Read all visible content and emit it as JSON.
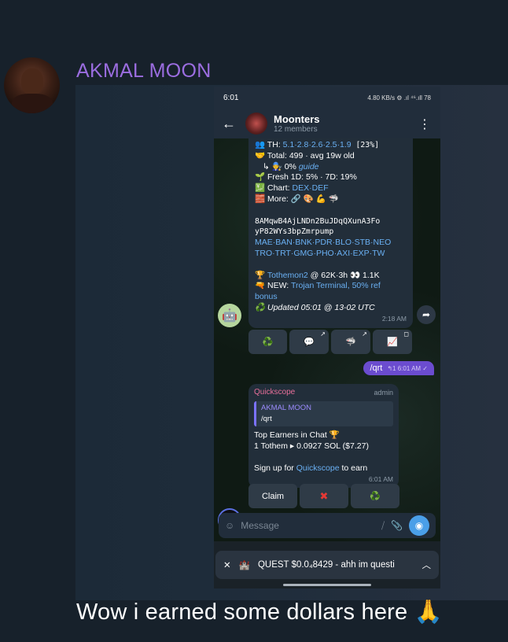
{
  "post": {
    "sender_name": "AKMAL MOON",
    "caption": "Wow i earned  some dollars here 🙏"
  },
  "phone": {
    "status": {
      "time": "6:01",
      "icons": "4.80 KB/s ⚙ .ıl ⁴⁶.ıll 78"
    },
    "header": {
      "title": "Moonters",
      "subtitle": "12 members"
    },
    "bot_message": {
      "lines": {
        "th_prefix": "👥 TH: ",
        "th_values": "5.1·2.8·2.6·2.5·1.9",
        "th_pct": " [23%]",
        "total": "🤝 Total: 499 · avg 19w old",
        "guide_prefix": "↳ 🧑‍🔧 0% ",
        "guide_link": "guide",
        "fresh": "🌱 Fresh 1D: 5% · 7D: 19%",
        "chart_prefix": "💹 Chart: ",
        "chart_link": "DEX·DEF",
        "more": "🧱 More: 🔗 🎨 💪 🦈",
        "addr1": "8AMqwB4AjLNDn2BuJDqQXunA3Fo",
        "addr2": "yP82WYs3bpZmrpump",
        "links1": "MAE·BAN·BNK·PDR·BLO·STB·NEO",
        "links2": "TRO·TRT·GMG·PHO·AXI·EXP·TW",
        "trophy_prefix": "🏆 ",
        "trophy_link": "Tothemon2",
        "trophy_rest": " @ 62K·3h 👀 1.1K",
        "new_prefix": "🔫 NEW: ",
        "new_link": "Trojan Terminal, 50% ref",
        "new_link2": "bonus",
        "updated": "♻️ Updated 05:01 @ 13-02 UTC"
      },
      "time": "2:18 AM"
    },
    "bot_buttons": [
      "♻️",
      "💬",
      "🦈",
      "📈"
    ],
    "outgoing": {
      "text": "/qrt",
      "meta": "↰1 6:01 AM ✓"
    },
    "quickscope": {
      "name": "Quickscope",
      "role": "admin",
      "quote_name": "AKMAL MOON",
      "quote_text": "/qrt",
      "line1": "Top Earners in Chat 🏆",
      "line2": "1 Tothem  ▸ 0.0927 SOL ($7.27)",
      "signup_prefix": "Sign up for ",
      "signup_link": "Quickscope",
      "signup_suffix": " to earn",
      "time": "6:01 AM"
    },
    "qs_buttons": [
      "Claim",
      "✖",
      "♻️"
    ],
    "input": {
      "placeholder": "Message"
    },
    "pinned": {
      "text": "QUEST $0.0₄8429 - ahh im questi"
    }
  },
  "colors": {
    "accent": "#9b6de0",
    "link": "#6ab0f3",
    "outgoing": "#6b4ccf"
  }
}
